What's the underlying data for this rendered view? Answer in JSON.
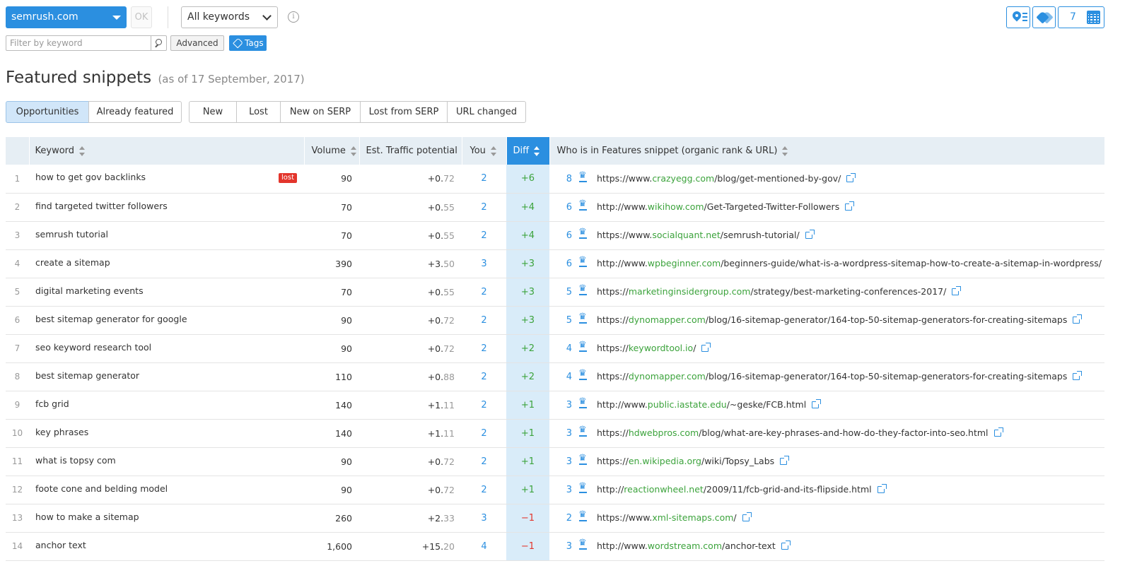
{
  "toolbar": {
    "domain": "semrush.com",
    "ok_label": "OK",
    "keyword_filter": "All keywords",
    "info_symbol": "i",
    "filter_placeholder": "Filter by keyword",
    "advanced_label": "Advanced",
    "tags_label": "Tags",
    "calendar_value": "7"
  },
  "heading": {
    "title": "Featured snippets",
    "date": "(as of 17 September, 2017)"
  },
  "tabs_primary": [
    {
      "label": "Opportunities",
      "active": true
    },
    {
      "label": "Already featured",
      "active": false
    }
  ],
  "tabs_secondary": [
    {
      "label": "New"
    },
    {
      "label": "Lost"
    },
    {
      "label": "New on SERP"
    },
    {
      "label": "Lost from SERP"
    },
    {
      "label": "URL changed"
    }
  ],
  "table": {
    "headers": {
      "keyword": "Keyword",
      "volume": "Volume",
      "etp": "Est. Traffic potential",
      "you": "You",
      "diff": "Diff",
      "who": "Who is in Features snippet (organic rank & URL)"
    },
    "rows": [
      {
        "n": "1",
        "keyword": "how to get gov backlinks",
        "badge": "lost",
        "volume": "90",
        "etp_int": "+0.",
        "etp_frac": "72",
        "you": "2",
        "diff": "+6",
        "rank": "8",
        "url_pre": "https://www.",
        "url_dom": "crazyegg.com",
        "url_post": "/blog/get-mentioned-by-gov/"
      },
      {
        "n": "2",
        "keyword": "find targeted twitter followers",
        "badge": "",
        "volume": "70",
        "etp_int": "+0.",
        "etp_frac": "55",
        "you": "2",
        "diff": "+4",
        "rank": "6",
        "url_pre": "http://www.",
        "url_dom": "wikihow.com",
        "url_post": "/Get-Targeted-Twitter-Followers"
      },
      {
        "n": "3",
        "keyword": "semrush tutorial",
        "badge": "",
        "volume": "70",
        "etp_int": "+0.",
        "etp_frac": "55",
        "you": "2",
        "diff": "+4",
        "rank": "6",
        "url_pre": "https://www.",
        "url_dom": "socialquant.net",
        "url_post": "/semrush-tutorial/"
      },
      {
        "n": "4",
        "keyword": "create a sitemap",
        "badge": "",
        "volume": "390",
        "etp_int": "+3.",
        "etp_frac": "50",
        "you": "3",
        "diff": "+3",
        "rank": "6",
        "url_pre": "http://www.",
        "url_dom": "wpbeginner.com",
        "url_post": "/beginners-guide/what-is-a-wordpress-sitemap-how-to-create-a-sitemap-in-wordpress/"
      },
      {
        "n": "5",
        "keyword": "digital marketing events",
        "badge": "",
        "volume": "70",
        "etp_int": "+0.",
        "etp_frac": "55",
        "you": "2",
        "diff": "+3",
        "rank": "5",
        "url_pre": "https://",
        "url_dom": "marketinginsidergroup.com",
        "url_post": "/strategy/best-marketing-conferences-2017/"
      },
      {
        "n": "6",
        "keyword": "best sitemap generator for google",
        "badge": "",
        "volume": "90",
        "etp_int": "+0.",
        "etp_frac": "72",
        "you": "2",
        "diff": "+3",
        "rank": "5",
        "url_pre": "https://",
        "url_dom": "dynomapper.com",
        "url_post": "/blog/16-sitemap-generator/164-top-50-sitemap-generators-for-creating-sitemaps"
      },
      {
        "n": "7",
        "keyword": "seo keyword research tool",
        "badge": "",
        "volume": "90",
        "etp_int": "+0.",
        "etp_frac": "72",
        "you": "2",
        "diff": "+2",
        "rank": "4",
        "url_pre": "https://",
        "url_dom": "keywordtool.io",
        "url_post": "/"
      },
      {
        "n": "8",
        "keyword": "best sitemap generator",
        "badge": "",
        "volume": "110",
        "etp_int": "+0.",
        "etp_frac": "88",
        "you": "2",
        "diff": "+2",
        "rank": "4",
        "url_pre": "https://",
        "url_dom": "dynomapper.com",
        "url_post": "/blog/16-sitemap-generator/164-top-50-sitemap-generators-for-creating-sitemaps"
      },
      {
        "n": "9",
        "keyword": "fcb grid",
        "badge": "",
        "volume": "140",
        "etp_int": "+1.",
        "etp_frac": "11",
        "you": "2",
        "diff": "+1",
        "rank": "3",
        "url_pre": "http://www.",
        "url_dom": "public.iastate.edu",
        "url_post": "/~geske/FCB.html"
      },
      {
        "n": "10",
        "keyword": "key phrases",
        "badge": "",
        "volume": "140",
        "etp_int": "+1.",
        "etp_frac": "11",
        "you": "2",
        "diff": "+1",
        "rank": "3",
        "url_pre": "https://",
        "url_dom": "hdwebpros.com",
        "url_post": "/blog/what-are-key-phrases-and-how-do-they-factor-into-seo.html"
      },
      {
        "n": "11",
        "keyword": "what is topsy com",
        "badge": "",
        "volume": "90",
        "etp_int": "+0.",
        "etp_frac": "72",
        "you": "2",
        "diff": "+1",
        "rank": "3",
        "url_pre": "https://",
        "url_dom": "en.wikipedia.org",
        "url_post": "/wiki/Topsy_Labs"
      },
      {
        "n": "12",
        "keyword": "foote cone and belding model",
        "badge": "",
        "volume": "90",
        "etp_int": "+0.",
        "etp_frac": "72",
        "you": "2",
        "diff": "+1",
        "rank": "3",
        "url_pre": "http://",
        "url_dom": "reactionwheel.net",
        "url_post": "/2009/11/fcb-grid-and-its-flipside.html"
      },
      {
        "n": "13",
        "keyword": "how to make a sitemap",
        "badge": "",
        "volume": "260",
        "etp_int": "+2.",
        "etp_frac": "33",
        "you": "3",
        "diff": "−1",
        "rank": "2",
        "url_pre": "https://www.",
        "url_dom": "xml-sitemaps.com",
        "url_post": "/"
      },
      {
        "n": "14",
        "keyword": "anchor text",
        "badge": "",
        "volume": "1,600",
        "etp_int": "+15.",
        "etp_frac": "20",
        "you": "4",
        "diff": "−1",
        "rank": "3",
        "url_pre": "http://www.",
        "url_dom": "wordstream.com",
        "url_post": "/anchor-text"
      }
    ]
  }
}
